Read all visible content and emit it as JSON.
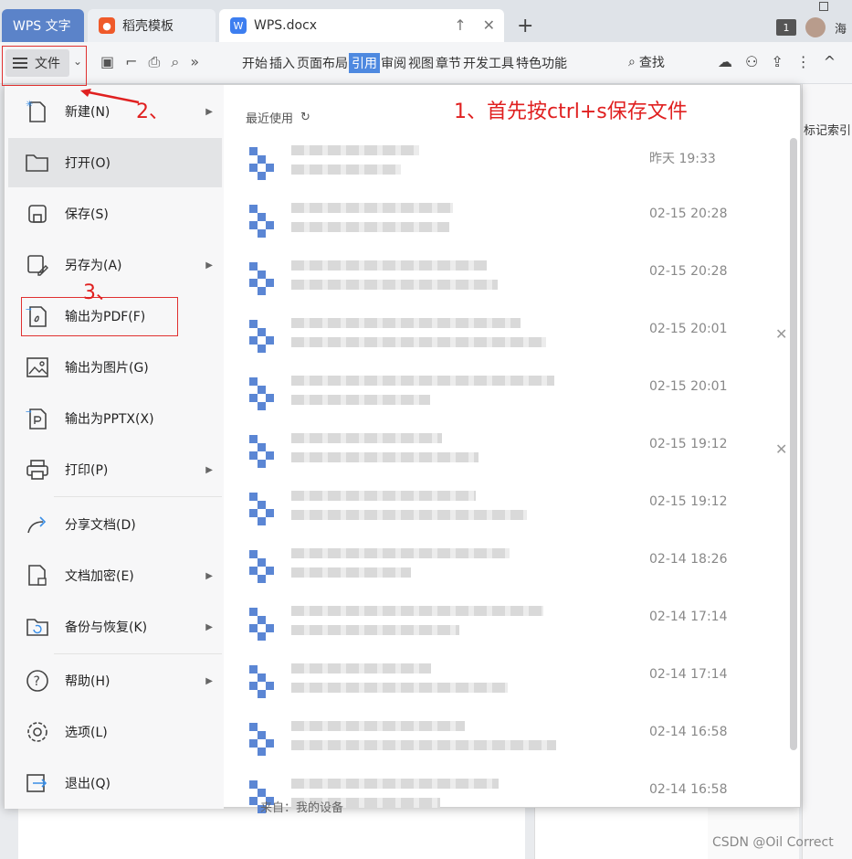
{
  "tabs": {
    "wps_label": "WPS 文字",
    "daoke_label": "稻壳模板",
    "doc_label": "WPS.docx",
    "user_name": "海",
    "window_count": "1"
  },
  "toolbar": {
    "file_label": "文件",
    "ribbon_tabs": [
      "开始",
      "插入",
      "页面布局",
      "引用",
      "审阅",
      "视图",
      "章节",
      "开发工具",
      "特色功能"
    ],
    "active_tab": "引用",
    "search_label": "查找",
    "bookmark_label": "标记索引"
  },
  "menu": {
    "items": [
      {
        "label": "新建(N)",
        "icon": "new-file-icon",
        "submenu": true
      },
      {
        "label": "打开(O)",
        "icon": "folder-open-icon",
        "submenu": false
      },
      {
        "label": "保存(S)",
        "icon": "save-icon",
        "submenu": false
      },
      {
        "label": "另存为(A)",
        "icon": "save-as-icon",
        "submenu": true
      },
      {
        "label": "输出为PDF(F)",
        "icon": "export-pdf-icon",
        "submenu": false
      },
      {
        "label": "输出为图片(G)",
        "icon": "export-image-icon",
        "submenu": false
      },
      {
        "label": "输出为PPTX(X)",
        "icon": "export-pptx-icon",
        "submenu": false
      },
      {
        "label": "打印(P)",
        "icon": "printer-icon",
        "submenu": true
      },
      {
        "label": "分享文档(D)",
        "icon": "share-icon",
        "submenu": false
      },
      {
        "label": "文档加密(E)",
        "icon": "encrypt-icon",
        "submenu": true
      },
      {
        "label": "备份与恢复(K)",
        "icon": "backup-icon",
        "submenu": true
      },
      {
        "label": "帮助(H)",
        "icon": "help-icon",
        "submenu": true
      },
      {
        "label": "选项(L)",
        "icon": "gear-icon",
        "submenu": false
      },
      {
        "label": "退出(Q)",
        "icon": "exit-icon",
        "submenu": false
      }
    ]
  },
  "recent": {
    "header": "最近使用",
    "items": [
      {
        "time": "昨天 19:33",
        "closable": false
      },
      {
        "time": "02-15 20:28",
        "closable": false
      },
      {
        "time": "02-15 20:28",
        "closable": false
      },
      {
        "time": "02-15 20:01",
        "closable": true
      },
      {
        "time": "02-15 20:01",
        "closable": false
      },
      {
        "time": "02-15 19:12",
        "closable": true
      },
      {
        "time": "02-15 19:12",
        "closable": false
      },
      {
        "time": "02-14 18:26",
        "closable": false
      },
      {
        "time": "02-14 17:14",
        "closable": false
      },
      {
        "time": "02-14 17:14",
        "closable": false
      },
      {
        "time": "02-14 16:58",
        "closable": false
      },
      {
        "time": "02-14 16:58",
        "closable": false
      }
    ],
    "source_label": "来自：我的设备"
  },
  "annotations": {
    "step1": "1、首先按ctrl+s保存文件",
    "step2": "2、",
    "step3": "3、",
    "color": "#e02020"
  },
  "watermark": "CSDN @Oil Correct"
}
